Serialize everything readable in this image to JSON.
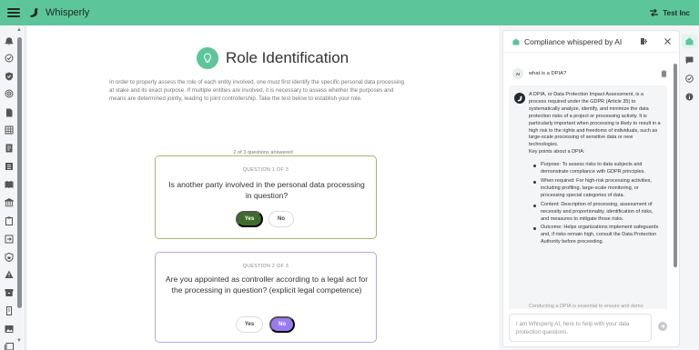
{
  "app": {
    "brand": "Whisperly",
    "account_label": "Test Inc",
    "accent_color": "#5cc59a"
  },
  "sidebar": {
    "icons": [
      "bell-icon",
      "check-circle-icon",
      "shield-icon",
      "radar-icon",
      "document-icon",
      "table-icon",
      "journal-icon",
      "list-icon",
      "book-icon",
      "bank-icon",
      "clipboard-icon",
      "import-icon",
      "shield-lock-icon",
      "warning-icon",
      "archive-icon",
      "folder-icon",
      "image-icon",
      "library-icon",
      "copy-icon"
    ]
  },
  "main": {
    "title": "Role Identification",
    "intro": "In order to properly assess the role of each entity involved, one must first identify the specific personal data processing at stake and its exact purpose. If multiple entities are involved, it is necessary to assess whether the purposes and means are determined jointly, leading to joint controllership. Take the test below to establish your role.",
    "progress_text": "2 of 3 questions answered",
    "progress_fraction": 0.667,
    "questions": [
      {
        "label": "QUESTION 1 OF 3",
        "text": "Is another party involved in the personal data processing in question?",
        "yes_label": "Yes",
        "no_label": "No",
        "selected": "Yes"
      },
      {
        "label": "QUESTION 2 OF 3",
        "text": "Are you appointed as controller according to a legal act for the processing in question? (explicit legal competence)",
        "yes_label": "Yes",
        "no_label": "No",
        "selected": "No"
      }
    ]
  },
  "panel": {
    "title": "Compliance whispered by AI",
    "user_avatar": "AI",
    "user_message": "what is a DPIA?",
    "bot_intro": "A DPIA, or Data Protection Impact Assessment, is a process required under the GDPR (Article 35) to systematically analyze, identify, and minimize the data protection risks of a project or processing activity. It is particularly important when processing is likely to result in a high risk to the rights and freedoms of individuals, such as large-scale processing of sensitive data or new technologies.",
    "bot_points_heading": "Key points about a DPIA:",
    "bot_points": [
      "Purpose: To assess risks to data subjects and demonstrate compliance with GDPR principles.",
      "When required: For high-risk processing activities, including profiling, large-scale monitoring, or processing special categories of data.",
      "Content: Description of processing, assessment of necessity and proportionality, identification of risks, and measures to mitigate those risks.",
      "Outcome: Helps organizations implement safeguards and, if risks remain high, consult the Data Protection Authority before proceeding."
    ],
    "cutoff_text": "Conducting a DPIA is essential to ensure and demo",
    "input_placeholder": "I am Whisperly AI, here to help with your data protection questions."
  }
}
